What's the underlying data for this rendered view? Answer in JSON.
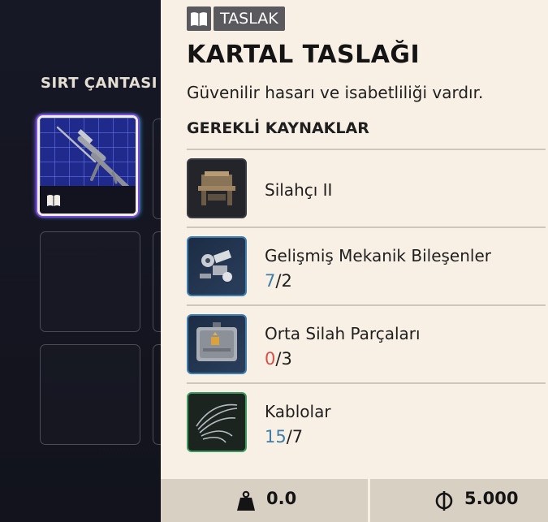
{
  "backpack": {
    "title": "SIRT ÇANTASI"
  },
  "item": {
    "badge_label": "TASLAK",
    "title": "KARTAL TASLAĞI",
    "description": "Güvenilir hasarı ve isabetliliği vardır.",
    "requirements_header": "GEREKLİ KAYNAKLAR"
  },
  "resources": [
    {
      "name": "Silahçı II",
      "icon": "workbench-icon"
    },
    {
      "name": "Gelişmiş Mekanik Bileşenler",
      "have": "7",
      "need": "/2",
      "have_status": "enough",
      "icon": "mechanical-parts-icon"
    },
    {
      "name": "Orta Silah Parçaları",
      "have": "0",
      "need": "/3",
      "have_status": "missing",
      "icon": "weapon-parts-case-icon"
    },
    {
      "name": "Kablolar",
      "have": "15",
      "need": "/7",
      "have_status": "enough",
      "icon": "cables-icon"
    }
  ],
  "footer": {
    "weight": "0.0",
    "price": "5.000",
    "weight_icon": "weight-icon",
    "currency_icon": "coin-icon"
  },
  "colors": {
    "panel_bg": "#f8f0e4",
    "enough": "#3e7ea8",
    "missing": "#d9504a",
    "selection_glow": "#7b5af0"
  }
}
